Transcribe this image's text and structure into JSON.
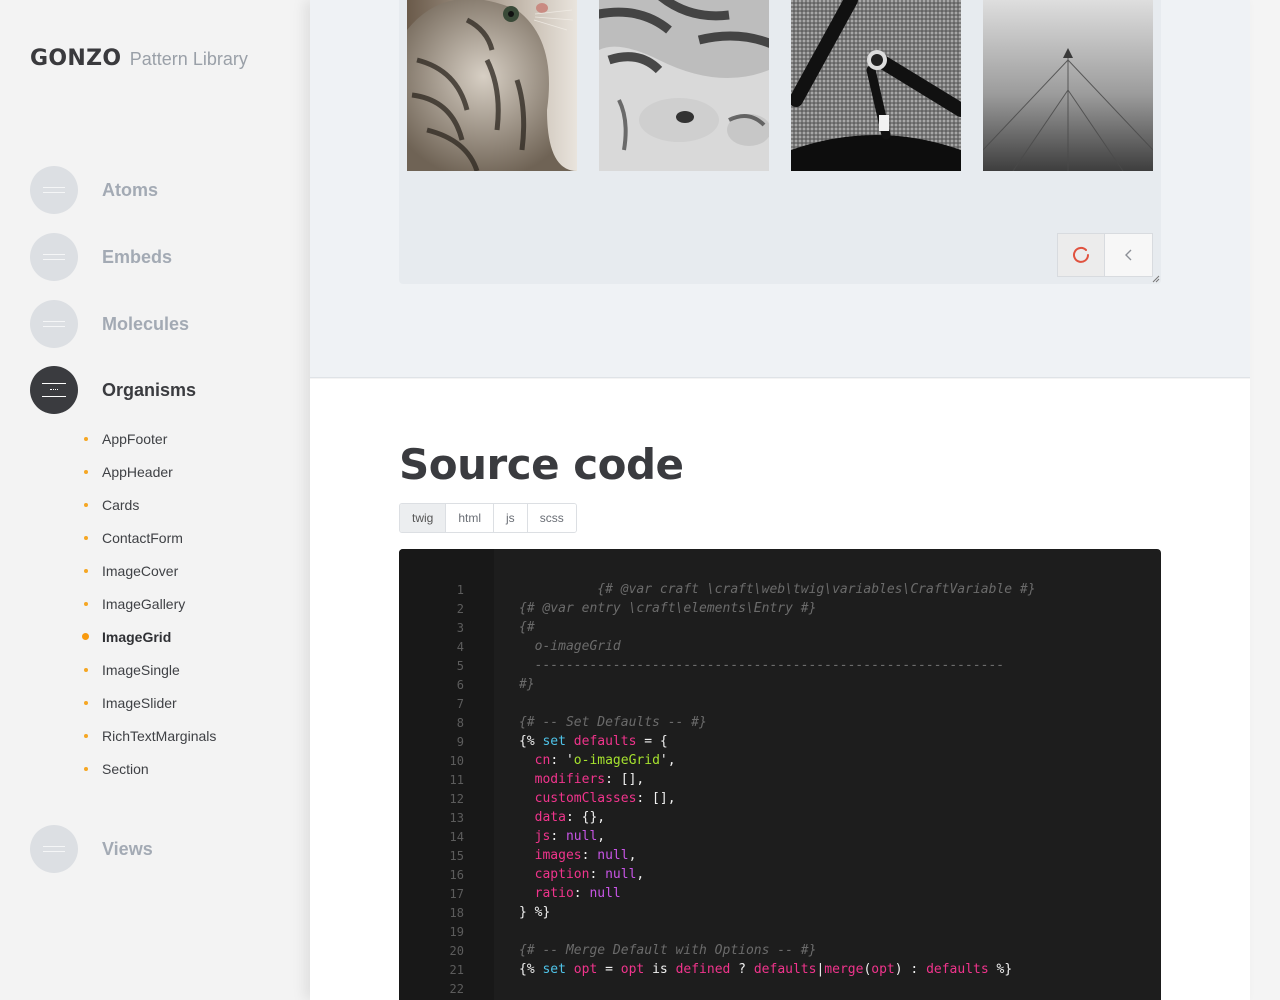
{
  "brand": {
    "name": "GONZO",
    "subtitle": "Pattern Library"
  },
  "categories": [
    {
      "label": "Atoms",
      "active": false
    },
    {
      "label": "Embeds",
      "active": false
    },
    {
      "label": "Molecules",
      "active": false
    },
    {
      "label": "Organisms",
      "active": true
    },
    {
      "label": "Views",
      "active": false
    }
  ],
  "organisms": [
    {
      "label": "AppFooter"
    },
    {
      "label": "AppHeader"
    },
    {
      "label": "Cards"
    },
    {
      "label": "ContactForm"
    },
    {
      "label": "ImageCover"
    },
    {
      "label": "ImageGallery"
    },
    {
      "label": "ImageGrid",
      "current": true
    },
    {
      "label": "ImageSingle"
    },
    {
      "label": "ImageSlider"
    },
    {
      "label": "RichTextMarginals"
    },
    {
      "label": "Section"
    }
  ],
  "preview": {
    "images": [
      "tabby-cat-portrait",
      "cat-paws-bw",
      "bicycle-handlebar-bw",
      "antenna-mast-fog"
    ],
    "controls": [
      "reload-icon",
      "chevron-left-icon"
    ]
  },
  "source": {
    "title": "Source code",
    "tabs": [
      "twig",
      "html",
      "js",
      "scss"
    ],
    "active_tab": "twig",
    "lines": [
      [
        [
          "c-com",
          "          {# @var craft \\craft\\web\\twig\\variables\\CraftVariable #}"
        ]
      ],
      [
        [
          "c-com",
          "{# @var entry \\craft\\elements\\Entry #}"
        ]
      ],
      [
        [
          "c-com",
          "{#"
        ]
      ],
      [
        [
          "c-com",
          "  o-imageGrid"
        ]
      ],
      [
        [
          "c-com",
          "  ------------------------------------------------------------"
        ]
      ],
      [
        [
          "c-com",
          "#}"
        ]
      ],
      [],
      [
        [
          "c-com",
          "{# -- Set Defaults -- #}"
        ]
      ],
      [
        [
          "c-pl",
          "{% "
        ],
        [
          "c-kw",
          "set"
        ],
        [
          "c-pl",
          " "
        ],
        [
          "c-var",
          "defaults"
        ],
        [
          "c-pl",
          " = {"
        ]
      ],
      [
        [
          "c-pl",
          "  "
        ],
        [
          "c-var",
          "cn"
        ],
        [
          "c-pl",
          ": '"
        ],
        [
          "c-str",
          "o-imageGrid"
        ],
        [
          "c-pl",
          "',"
        ]
      ],
      [
        [
          "c-pl",
          "  "
        ],
        [
          "c-var",
          "modifiers"
        ],
        [
          "c-pl",
          ": [],"
        ]
      ],
      [
        [
          "c-pl",
          "  "
        ],
        [
          "c-var",
          "customClasses"
        ],
        [
          "c-pl",
          ": [],"
        ]
      ],
      [
        [
          "c-pl",
          "  "
        ],
        [
          "c-var",
          "data"
        ],
        [
          "c-pl",
          ": {},"
        ]
      ],
      [
        [
          "c-pl",
          "  "
        ],
        [
          "c-var",
          "js"
        ],
        [
          "c-pl",
          ": "
        ],
        [
          "c-null",
          "null"
        ],
        [
          "c-pl",
          ","
        ]
      ],
      [
        [
          "c-pl",
          "  "
        ],
        [
          "c-var",
          "images"
        ],
        [
          "c-pl",
          ": "
        ],
        [
          "c-null",
          "null"
        ],
        [
          "c-pl",
          ","
        ]
      ],
      [
        [
          "c-pl",
          "  "
        ],
        [
          "c-var",
          "caption"
        ],
        [
          "c-pl",
          ": "
        ],
        [
          "c-null",
          "null"
        ],
        [
          "c-pl",
          ","
        ]
      ],
      [
        [
          "c-pl",
          "  "
        ],
        [
          "c-var",
          "ratio"
        ],
        [
          "c-pl",
          ": "
        ],
        [
          "c-null",
          "null"
        ]
      ],
      [
        [
          "c-pl",
          "} %}"
        ]
      ],
      [],
      [
        [
          "c-com",
          "{# -- Merge Default with Options -- #}"
        ]
      ],
      [
        [
          "c-pl",
          "{% "
        ],
        [
          "c-kw",
          "set"
        ],
        [
          "c-pl",
          " "
        ],
        [
          "c-var",
          "opt"
        ],
        [
          "c-pl",
          " = "
        ],
        [
          "c-var",
          "opt"
        ],
        [
          "c-pl",
          " is "
        ],
        [
          "c-var",
          "defined"
        ],
        [
          "c-pl",
          " ? "
        ],
        [
          "c-var",
          "defaults"
        ],
        [
          "c-pl",
          "|"
        ],
        [
          "c-var",
          "merge"
        ],
        [
          "c-pl",
          "("
        ],
        [
          "c-var",
          "opt"
        ],
        [
          "c-pl",
          ") : "
        ],
        [
          "c-var",
          "defaults"
        ],
        [
          "c-pl",
          " %}"
        ]
      ],
      []
    ]
  }
}
